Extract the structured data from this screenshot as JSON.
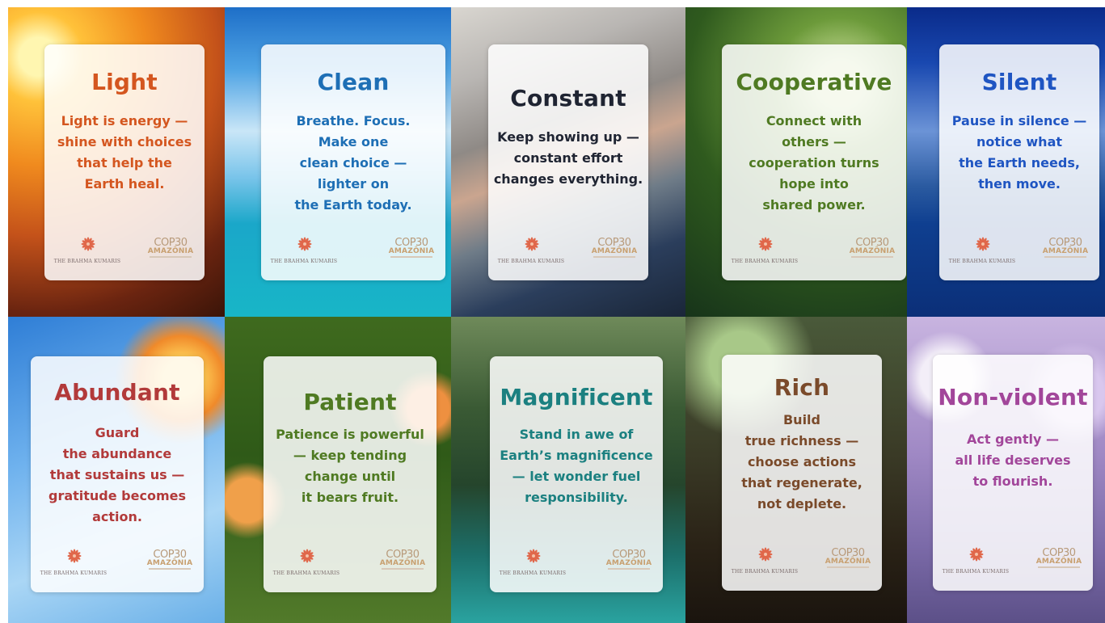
{
  "cards": [
    {
      "title": "Light",
      "lines": [
        "Light is energy —",
        "shine with choices",
        "that help the",
        "Earth heal."
      ],
      "color": "#d4561f"
    },
    {
      "title": "Clean",
      "lines": [
        "Breathe. Focus.",
        "Make one",
        "clean choice —",
        "lighter on",
        "the Earth today."
      ],
      "color": "#1e6fb5"
    },
    {
      "title": "Constant",
      "lines": [
        "Keep showing up —",
        "constant effort",
        "changes everything."
      ],
      "color": "#1f2432"
    },
    {
      "title": "Cooperative",
      "lines": [
        "Connect with",
        "others  —",
        "cooperation turns",
        "hope into",
        "shared power."
      ],
      "color": "#4f7a22"
    },
    {
      "title": "Silent",
      "lines": [
        "Pause in silence —",
        "notice what",
        "the Earth needs,",
        "then move."
      ],
      "color": "#1f55c2"
    },
    {
      "title": "Abundant",
      "lines": [
        "Guard",
        "the abundance",
        "that sustains us —",
        "gratitude becomes",
        "action."
      ],
      "color": "#b23a3a"
    },
    {
      "title": "Patient",
      "lines": [
        "Patience is powerful",
        "— keep tending",
        "change until",
        "it bears fruit."
      ],
      "color": "#4f7a22"
    },
    {
      "title": "Magnificent",
      "lines": [
        "Stand in awe of",
        "Earth’s magnificence",
        "— let wonder fuel",
        "responsibility."
      ],
      "color": "#1b8080"
    },
    {
      "title": "Rich",
      "lines": [
        "Build",
        "true richness —",
        "choose actions",
        "that regenerate,",
        "not deplete."
      ],
      "color": "#7a4a2a"
    },
    {
      "title": "Non-violent",
      "lines": [
        "Act gently —",
        "all life deserves",
        "to flourish."
      ],
      "color": "#a2469a"
    }
  ],
  "logos": {
    "bk_text": "THE BRAHMA KUMARIS",
    "cop_text": "COP30",
    "amazonia_text": "AMAZÔNIA"
  }
}
